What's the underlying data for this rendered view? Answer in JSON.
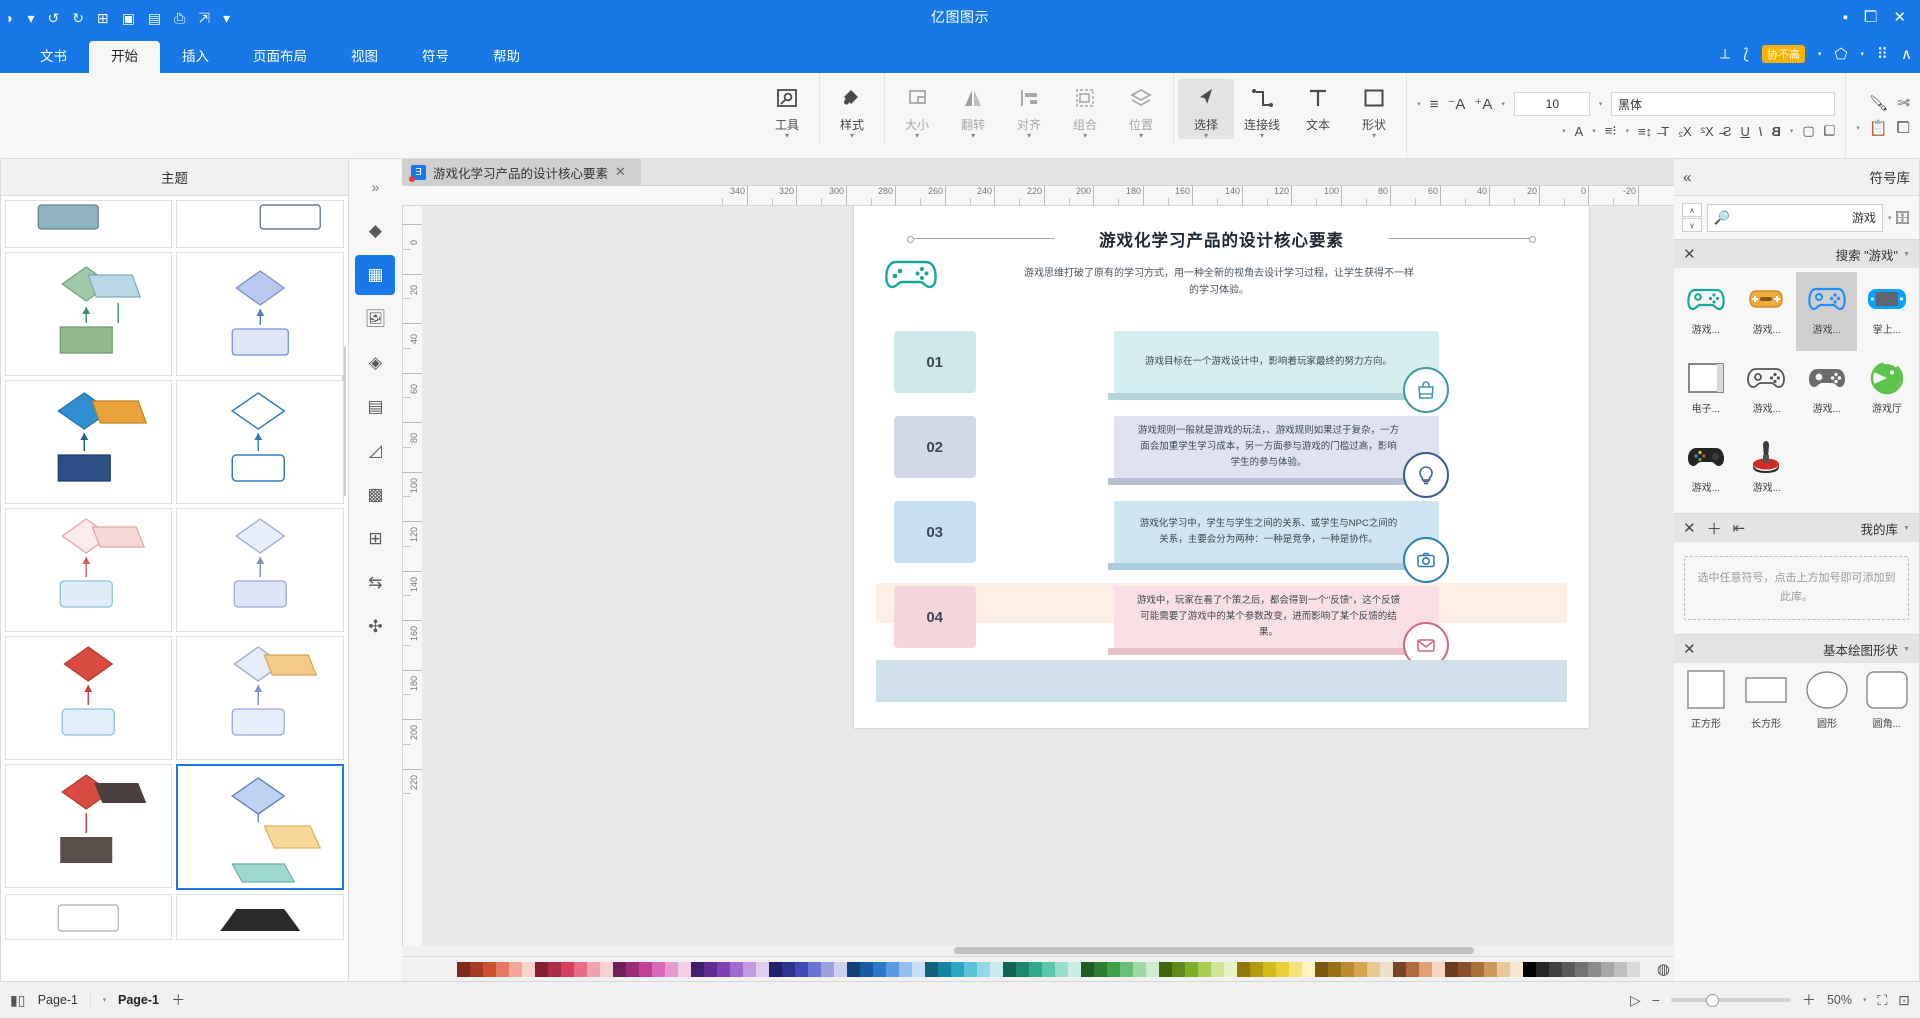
{
  "app": {
    "window_title": "亿图图示",
    "titlebar_icons": [
      "close-icon",
      "restore-icon",
      "minimize-icon"
    ],
    "right_icons": [
      "account-icon",
      "redo-icon",
      "undo-icon",
      "add-icon",
      "save-icon",
      "print-icon",
      "share-icon",
      "cloud-icon",
      "more-icon"
    ]
  },
  "quick_access": {
    "items": [
      "cursor-icon",
      "pointer-icon",
      "ai-label",
      "shape-icon",
      "grid-icon",
      "chevron-icon"
    ],
    "ai_label": "协不高"
  },
  "tabs": [
    {
      "label": "文书",
      "active": false
    },
    {
      "label": "开始",
      "active": true
    },
    {
      "label": "插入",
      "active": false
    },
    {
      "label": "页面布局",
      "active": false
    },
    {
      "label": "视图",
      "active": false
    },
    {
      "label": "符号",
      "active": false
    },
    {
      "label": "帮助",
      "active": false
    }
  ],
  "ribbon": {
    "groups": [
      {
        "buttons": [
          {
            "label": "工具",
            "icon": "tool-icon",
            "dim": false,
            "arrow": true
          }
        ]
      },
      {
        "buttons": [
          {
            "label": "样式",
            "icon": "fill-icon",
            "dim": false,
            "arrow": true
          }
        ]
      },
      {
        "buttons": [
          {
            "label": "大小",
            "icon": "size-icon",
            "dim": true,
            "arrow": true
          },
          {
            "label": "翻转",
            "icon": "flip-icon",
            "dim": true,
            "arrow": true
          },
          {
            "label": "对齐",
            "icon": "align-icon",
            "dim": true,
            "arrow": true
          },
          {
            "label": "组合",
            "icon": "group-icon",
            "dim": true,
            "arrow": true
          },
          {
            "label": "位置",
            "icon": "layer-icon",
            "dim": true,
            "arrow": true
          }
        ]
      },
      {
        "buttons": [
          {
            "label": "选择",
            "icon": "select-icon",
            "dim": false,
            "arrow": true,
            "selected": true
          },
          {
            "label": "连接线",
            "icon": "connector-icon",
            "dim": false,
            "arrow": true
          },
          {
            "label": "文本",
            "icon": "text-icon",
            "dim": false,
            "arrow": false
          },
          {
            "label": "形状",
            "icon": "shape-icon",
            "dim": false,
            "arrow": true
          }
        ]
      }
    ],
    "font_name": "黑体",
    "font_size": "10",
    "format_icons_row1": [
      "align-icon",
      "decrease-font-icon",
      "increase-font-icon"
    ],
    "format_icons_row2": [
      "font-color-icon",
      "highlight-icon",
      "bullets-icon",
      "line-spacing-icon",
      "subscript-icon",
      "clear-format-icon",
      "strikethrough-icon",
      "underline-icon",
      "italic-icon",
      "bold-icon"
    ],
    "right_icons": [
      "copy-icon",
      "paste-icon",
      "cut-icon",
      "format-painter-icon"
    ]
  },
  "left_panel": {
    "header": "主题",
    "templates": [
      {
        "name": "flow-1"
      },
      {
        "name": "flow-2"
      },
      {
        "name": "flow-3"
      },
      {
        "name": "flow-4"
      },
      {
        "name": "flow-5"
      },
      {
        "name": "flow-6"
      },
      {
        "name": "flow-7"
      },
      {
        "name": "flow-8"
      },
      {
        "name": "flow-9"
      },
      {
        "name": "flow-10"
      },
      {
        "name": "flow-11"
      },
      {
        "name": "flow-12"
      }
    ]
  },
  "vertical_strip": {
    "items": [
      "collapse-icon",
      "fill-icon",
      "grid-icon",
      "image-icon",
      "layers-icon",
      "notes-icon",
      "chart-icon",
      "table-icon",
      "frame-icon",
      "flow-icon",
      "arrange-icon"
    ]
  },
  "document": {
    "tab_title": "游戏化学习产品的设计核心要素",
    "close_label": "×"
  },
  "ruler": {
    "horizontal": [
      "-20",
      "0",
      "20",
      "40",
      "60",
      "80",
      "100",
      "120",
      "140",
      "160",
      "180",
      "200",
      "220",
      "240",
      "260",
      "280",
      "300",
      "320",
      "340"
    ],
    "vertical": [
      "0",
      "20",
      "40",
      "60",
      "80",
      "100",
      "120",
      "140",
      "160",
      "180",
      "200",
      "220"
    ]
  },
  "infographic": {
    "title": "游戏化学习产品的设计核心要素",
    "subtitle": "游戏思维打破了原有的学习方式，用一种全新的视角去设计学习过程，让学生获得不一样的学习体验。",
    "items": [
      {
        "number": "01",
        "icon": "bag-icon",
        "text": "游戏目标在一个游戏设计中，影响着玩家最终的努力方向。",
        "card_color": "#d6eef0",
        "num_color": "#cfe8ec",
        "shadow_color": "#9cc6cd",
        "badge_color": "#3f9aa5"
      },
      {
        "number": "02",
        "icon": "bulb-icon",
        "text": "游戏规则一般就是游戏的玩法，、游戏规则如果过于复杂，一方面会加重学生学习成本，另一方面参与游戏的门槛过高，影响学生的参与体验。",
        "card_color": "#dfe3ef",
        "num_color": "#d3d8e8",
        "shadow_color": "#9fa8c4",
        "badge_color": "#3a5a9a"
      },
      {
        "number": "03",
        "icon": "camera-icon",
        "text": "游戏化学习中，学生与学生之间的关系、或学生与NPC之间的关系，主要会分为两种：一种是竞争，一种是协作。",
        "card_color": "#cfe5f2",
        "num_color": "#c7dff0",
        "shadow_color": "#8fb9d6",
        "badge_color": "#2f7fb5"
      },
      {
        "number": "04",
        "icon": "mail-icon",
        "text": "游戏中，玩家在看了个策之后，都会得到一个\"反馈\"，这个反馈可能需要了游戏中的某个参数改变，进而影响了某个反馈的结果。",
        "card_color": "#fadfe4",
        "num_color": "#f7d5dc",
        "shadow_color": "#e2a8b4",
        "badge_color": "#d4687f"
      }
    ]
  },
  "right_panel": {
    "title": "符号库",
    "collapse_icon": "chevron-right-icon",
    "search_value": "游戏",
    "search_icon": "search-icon",
    "library_label": "库",
    "search_section": {
      "header": "搜索 \"游戏\"",
      "symbols": [
        {
          "label": "掌上...",
          "icon": "handheld-console",
          "selected": false
        },
        {
          "label": "游戏...",
          "icon": "gamepad-blue",
          "selected": true
        },
        {
          "label": "游戏...",
          "icon": "gamepad-orange",
          "selected": false
        },
        {
          "label": "游戏...",
          "icon": "gamepad-teal",
          "selected": false
        },
        {
          "label": "游戏厅",
          "icon": "pacman-green",
          "selected": false
        },
        {
          "label": "游戏...",
          "icon": "gamepad-gray",
          "selected": false
        },
        {
          "label": "游戏...",
          "icon": "gamepad-outline",
          "selected": false
        },
        {
          "label": "电子...",
          "icon": "screen-white",
          "selected": false
        },
        {
          "label": "游戏...",
          "icon": "joystick-red",
          "selected": false
        },
        {
          "label": "游戏...",
          "icon": "gamepad-black",
          "selected": false
        }
      ]
    },
    "my_library": {
      "header": "我的库",
      "actions": [
        "import-icon",
        "add-icon",
        "close-icon"
      ],
      "dropzone_text": "选中任意符号，点击上方加号即可添加到此库。"
    },
    "basic_shapes": {
      "header": "基本绘图形状",
      "shapes": [
        {
          "label": "圆角...",
          "icon": "rounded-rect"
        },
        {
          "label": "圆形",
          "icon": "circle"
        },
        {
          "label": "长方形",
          "icon": "rectangle"
        },
        {
          "label": "正方形",
          "icon": "square"
        }
      ]
    }
  },
  "status_bar": {
    "fit_icon": "fit-page-icon",
    "fullscreen_icon": "fullscreen-icon",
    "zoom_level": "50%",
    "zoom_out": "−",
    "zoom_in": "+",
    "presentation_icon": "presentation-icon",
    "page_tab": "Page-1",
    "page_name": "Page-1",
    "add_page": "+",
    "view_icon": "view-mode-icon"
  },
  "palette": {
    "colors": [
      "#f0f0f0",
      "#d9d9d9",
      "#bfbfbf",
      "#a6a6a6",
      "#8c8c8c",
      "#737373",
      "#595959",
      "#404040",
      "#262626",
      "#000000",
      "#f7e7d0",
      "#e8c79a",
      "#c99a5b",
      "#a8703a",
      "#8a5228",
      "#6b3c1b",
      "#f5d6c0",
      "#e0a07a",
      "#b06a3e",
      "#7a4426",
      "#efe0c8",
      "#e4c994",
      "#d2a74f",
      "#b98b2c",
      "#9a6f18",
      "#7b5710",
      "#fdf3c0",
      "#f6e27a",
      "#e8cf3a",
      "#d4b91a",
      "#b39a0f",
      "#90790a",
      "#e8f3c4",
      "#cfe596",
      "#a9cc55",
      "#7fae2a",
      "#5f8a18",
      "#44650f",
      "#cdeccd",
      "#9fd8a3",
      "#6bbf74",
      "#3fa04c",
      "#2b7d36",
      "#1d5c26",
      "#c9eee4",
      "#96ddcc",
      "#5cc7ad",
      "#2faa8d",
      "#1d8670",
      "#136253",
      "#c9ecf2",
      "#95d9e7",
      "#5ac3d8",
      "#2aa6c4",
      "#1883a0",
      "#0f6278",
      "#c8def5",
      "#93bfec",
      "#5a9ade",
      "#2b78cc",
      "#1a5aa3",
      "#11417a",
      "#cdd0ef",
      "#9ba1e0",
      "#6b74cf",
      "#4049b5",
      "#2d3490",
      "#1d226b",
      "#e0cdef",
      "#c29be0",
      "#a06bcf",
      "#7f40b5",
      "#5f2d90",
      "#40206b",
      "#f3cfe7",
      "#e69bd0",
      "#d96bb9",
      "#c0409a",
      "#962f78",
      "#6d2156",
      "#f9d0d6",
      "#f2a0ae",
      "#e66f85",
      "#d6405f",
      "#ad2c46",
      "#841f33",
      "#f7d3cb",
      "#efa898",
      "#e37a63",
      "#d04f33",
      "#a73c24",
      "#7d2b18"
    ]
  }
}
